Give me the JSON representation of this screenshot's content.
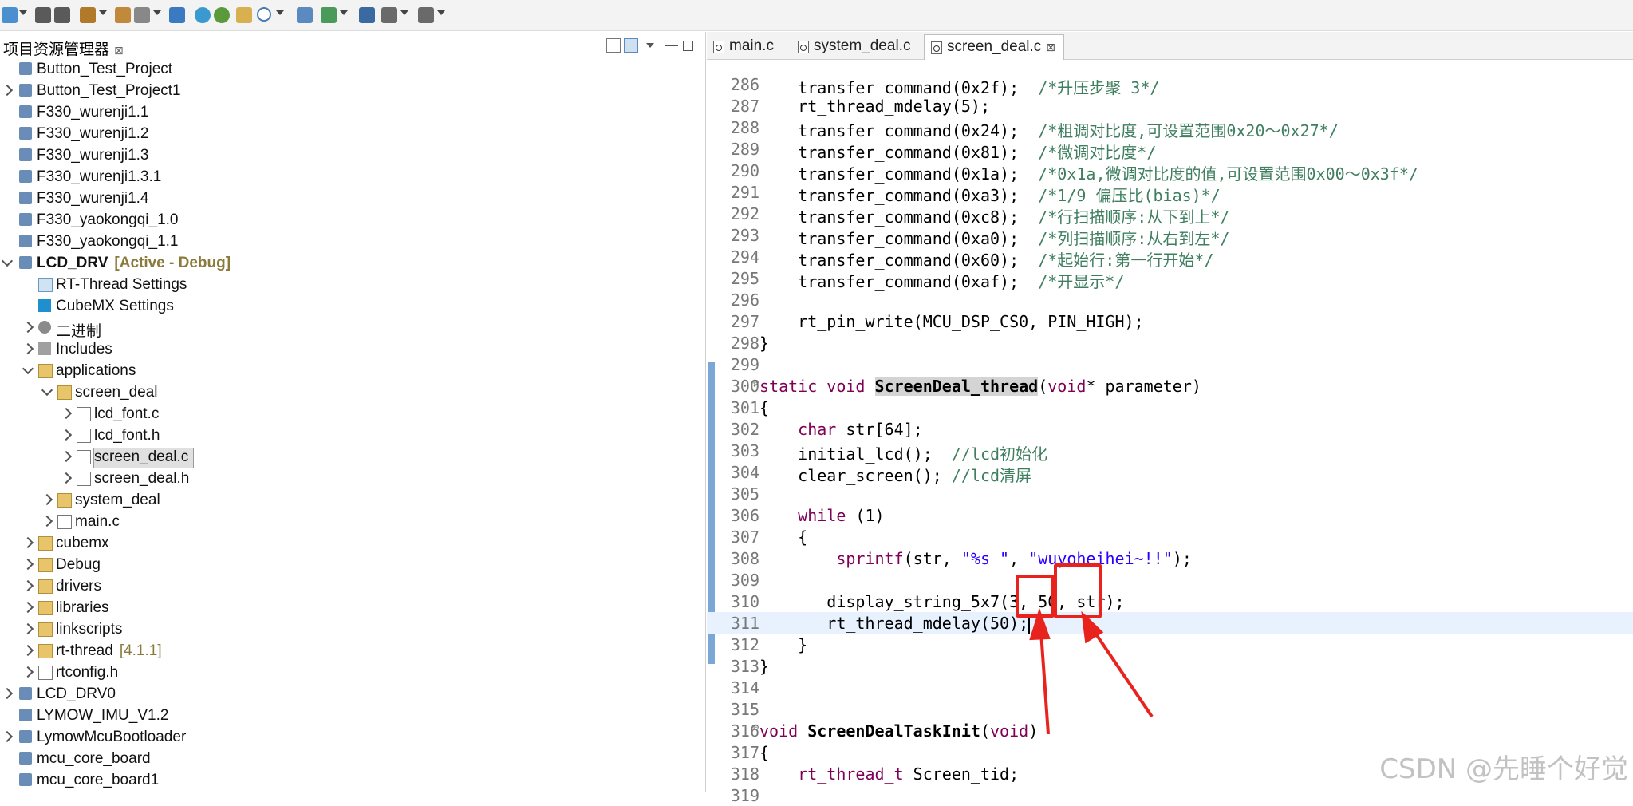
{
  "explorer": {
    "title": "项目资源管理器",
    "close_glyph": "⊠",
    "items": [
      {
        "label": "Button_Test_Project",
        "decorator": "",
        "depth": 0,
        "chevron": "none",
        "icon": "project-icon"
      },
      {
        "label": "Button_Test_Project1",
        "decorator": "",
        "depth": 0,
        "chevron": "closed",
        "icon": "project-icon"
      },
      {
        "label": "F330_wurenji1.1",
        "decorator": "",
        "depth": 0,
        "chevron": "none",
        "icon": "project-icon"
      },
      {
        "label": "F330_wurenji1.2",
        "decorator": "",
        "depth": 0,
        "chevron": "none",
        "icon": "project-icon"
      },
      {
        "label": "F330_wurenji1.3",
        "decorator": "",
        "depth": 0,
        "chevron": "none",
        "icon": "project-icon"
      },
      {
        "label": "F330_wurenji1.3.1",
        "decorator": "",
        "depth": 0,
        "chevron": "none",
        "icon": "project-icon"
      },
      {
        "label": "F330_wurenji1.4",
        "decorator": "",
        "depth": 0,
        "chevron": "none",
        "icon": "project-icon"
      },
      {
        "label": "F330_yaokongqi_1.0",
        "decorator": "",
        "depth": 0,
        "chevron": "none",
        "icon": "project-icon"
      },
      {
        "label": "F330_yaokongqi_1.1",
        "decorator": "",
        "depth": 0,
        "chevron": "none",
        "icon": "project-icon"
      },
      {
        "label": "LCD_DRV",
        "decorator": "[Active - Debug]",
        "depth": 0,
        "chevron": "open",
        "icon": "project-icon",
        "bold": true
      },
      {
        "label": "RT-Thread Settings",
        "decorator": "",
        "depth": 1,
        "chevron": "none",
        "icon": "rt-settings-icon"
      },
      {
        "label": "CubeMX Settings",
        "decorator": "",
        "depth": 1,
        "chevron": "none",
        "icon": "cubemx-icon"
      },
      {
        "label": "二进制",
        "decorator": "",
        "depth": 1,
        "chevron": "closed",
        "icon": "binaries-icon"
      },
      {
        "label": "Includes",
        "decorator": "",
        "depth": 1,
        "chevron": "closed",
        "icon": "includes-icon"
      },
      {
        "label": "applications",
        "decorator": "",
        "depth": 1,
        "chevron": "open",
        "icon": "folder-icon"
      },
      {
        "label": "screen_deal",
        "decorator": "",
        "depth": 2,
        "chevron": "open",
        "icon": "folder-icon"
      },
      {
        "label": "lcd_font.c",
        "decorator": "",
        "depth": 3,
        "chevron": "closed",
        "icon": "c-file-icon"
      },
      {
        "label": "lcd_font.h",
        "decorator": "",
        "depth": 3,
        "chevron": "closed",
        "icon": "h-file-icon"
      },
      {
        "label": "screen_deal.c",
        "decorator": "",
        "depth": 3,
        "chevron": "closed",
        "icon": "c-file-icon",
        "selected": true
      },
      {
        "label": "screen_deal.h",
        "decorator": "",
        "depth": 3,
        "chevron": "closed",
        "icon": "h-file-icon"
      },
      {
        "label": "system_deal",
        "decorator": "",
        "depth": 2,
        "chevron": "closed",
        "icon": "folder-icon"
      },
      {
        "label": "main.c",
        "decorator": "",
        "depth": 2,
        "chevron": "closed",
        "icon": "c-file-icon"
      },
      {
        "label": "cubemx",
        "decorator": "",
        "depth": 1,
        "chevron": "closed",
        "icon": "folder-icon"
      },
      {
        "label": "Debug",
        "decorator": "",
        "depth": 1,
        "chevron": "closed",
        "icon": "folder-icon"
      },
      {
        "label": "drivers",
        "decorator": "",
        "depth": 1,
        "chevron": "closed",
        "icon": "folder-icon"
      },
      {
        "label": "libraries",
        "decorator": "",
        "depth": 1,
        "chevron": "closed",
        "icon": "folder-icon"
      },
      {
        "label": "linkscripts",
        "decorator": "",
        "depth": 1,
        "chevron": "closed",
        "icon": "folder-icon"
      },
      {
        "label": "rt-thread",
        "decorator": "[4.1.1]",
        "depth": 1,
        "chevron": "closed",
        "icon": "folder-icon"
      },
      {
        "label": "rtconfig.h",
        "decorator": "",
        "depth": 1,
        "chevron": "closed",
        "icon": "h-file-icon"
      },
      {
        "label": "LCD_DRV0",
        "decorator": "",
        "depth": 0,
        "chevron": "closed",
        "icon": "project-icon"
      },
      {
        "label": "LYMOW_IMU_V1.2",
        "decorator": "",
        "depth": 0,
        "chevron": "none",
        "icon": "project-icon"
      },
      {
        "label": "LymowMcuBootloader",
        "decorator": "",
        "depth": 0,
        "chevron": "closed",
        "icon": "project-icon"
      },
      {
        "label": "mcu_core_board",
        "decorator": "",
        "depth": 0,
        "chevron": "none",
        "icon": "project-icon"
      },
      {
        "label": "mcu_core_board1",
        "decorator": "",
        "depth": 0,
        "chevron": "none",
        "icon": "project-icon"
      }
    ]
  },
  "editor": {
    "tabs": [
      {
        "label": "main.c",
        "active": false,
        "close": ""
      },
      {
        "label": "system_deal.c",
        "active": false,
        "close": ""
      },
      {
        "label": "screen_deal.c",
        "active": true,
        "close": "⊠"
      }
    ],
    "lines": [
      {
        "n": "286",
        "fold": "",
        "html": "    transfer_command(0x2f);  <span class=\"cm\">/*升压步聚 3*/</span>"
      },
      {
        "n": "287",
        "fold": "",
        "html": "    rt_thread_mdelay(5);"
      },
      {
        "n": "288",
        "fold": "",
        "html": "    transfer_command(0x24);  <span class=\"cm\">/*粗调对比度,可设置范围0x20～0x27*/</span>"
      },
      {
        "n": "289",
        "fold": "",
        "html": "    transfer_command(0x81);  <span class=\"cm\">/*微调对比度*/</span>"
      },
      {
        "n": "290",
        "fold": "",
        "html": "    transfer_command(0x1a);  <span class=\"cm\">/*0x1a,微调对比度的值,可设置范围0x00～0x3f*/</span>"
      },
      {
        "n": "291",
        "fold": "",
        "html": "    transfer_command(0xa3);  <span class=\"cm\">/*1/9 偏压比(bias)*/</span>"
      },
      {
        "n": "292",
        "fold": "",
        "html": "    transfer_command(0xc8);  <span class=\"cm\">/*行扫描顺序:从下到上*/</span>"
      },
      {
        "n": "293",
        "fold": "",
        "html": "    transfer_command(0xa0);  <span class=\"cm\">/*列扫描顺序:从右到左*/</span>"
      },
      {
        "n": "294",
        "fold": "",
        "html": "    transfer_command(0x60);  <span class=\"cm\">/*起始行:第一行开始*/</span>"
      },
      {
        "n": "295",
        "fold": "",
        "html": "    transfer_command(0xaf);  <span class=\"cm\">/*开显示*/</span>"
      },
      {
        "n": "296",
        "fold": "",
        "html": ""
      },
      {
        "n": "297",
        "fold": "",
        "html": "    rt_pin_write(MCU_DSP_CS0, PIN_HIGH);"
      },
      {
        "n": "298",
        "fold": "",
        "html": "}"
      },
      {
        "n": "299",
        "fold": "",
        "html": ""
      },
      {
        "n": "300",
        "fold": "⊖",
        "html": "<span class=\"kw2\">static</span> <span class=\"kw2\">void</span> <span class=\"fnhl\">ScreenDeal_thread</span>(<span class=\"kw2\">void</span>* parameter)"
      },
      {
        "n": "301",
        "fold": "",
        "html": "{"
      },
      {
        "n": "302",
        "fold": "",
        "html": "    <span class=\"kw2\">char</span> str[64];"
      },
      {
        "n": "303",
        "fold": "",
        "html": "    initial_lcd();  <span class=\"cm\">//lcd初始化</span>"
      },
      {
        "n": "304",
        "fold": "",
        "html": "    clear_screen(); <span class=\"cm\">//lcd清屏</span>"
      },
      {
        "n": "305",
        "fold": "",
        "html": ""
      },
      {
        "n": "306",
        "fold": "",
        "html": "    <span class=\"kw2\">while</span> (1)"
      },
      {
        "n": "307",
        "fold": "",
        "html": "    {"
      },
      {
        "n": "308",
        "fold": "",
        "html": "        <span class=\"kw2\">sprintf</span>(str, <span class=\"str\">\"%s \"</span>, <span class=\"str\">\"wuyoheihei~!!\"</span>);"
      },
      {
        "n": "309",
        "fold": "",
        "html": ""
      },
      {
        "n": "310",
        "fold": "",
        "html": "       display_string_5x7(3, 50, str);"
      },
      {
        "n": "311",
        "fold": "",
        "html": "       rt_thread_mdelay(50);<span class=\"cursor\"></span>",
        "current": true
      },
      {
        "n": "312",
        "fold": "",
        "html": "    }"
      },
      {
        "n": "313",
        "fold": "",
        "html": "}"
      },
      {
        "n": "314",
        "fold": "",
        "html": ""
      },
      {
        "n": "315",
        "fold": "",
        "html": ""
      },
      {
        "n": "316",
        "fold": "⊖",
        "html": "<span class=\"kw2\">void</span> <span class=\"fnb\">ScreenDealTaskInit</span>(<span class=\"kw2\">void</span>)"
      },
      {
        "n": "317",
        "fold": "",
        "html": "{"
      },
      {
        "n": "318",
        "fold": "",
        "html": "    <span class=\"kw2\">rt_thread_t</span> Screen_tid;"
      },
      {
        "n": "319",
        "fold": "",
        "html": ""
      }
    ]
  },
  "watermark": "CSDN @先睡个好觉",
  "colors": {
    "annotation_red": "#e8231d",
    "keyword": "#7f0055",
    "comment": "#3f7f5f",
    "string": "#2a00ff"
  }
}
